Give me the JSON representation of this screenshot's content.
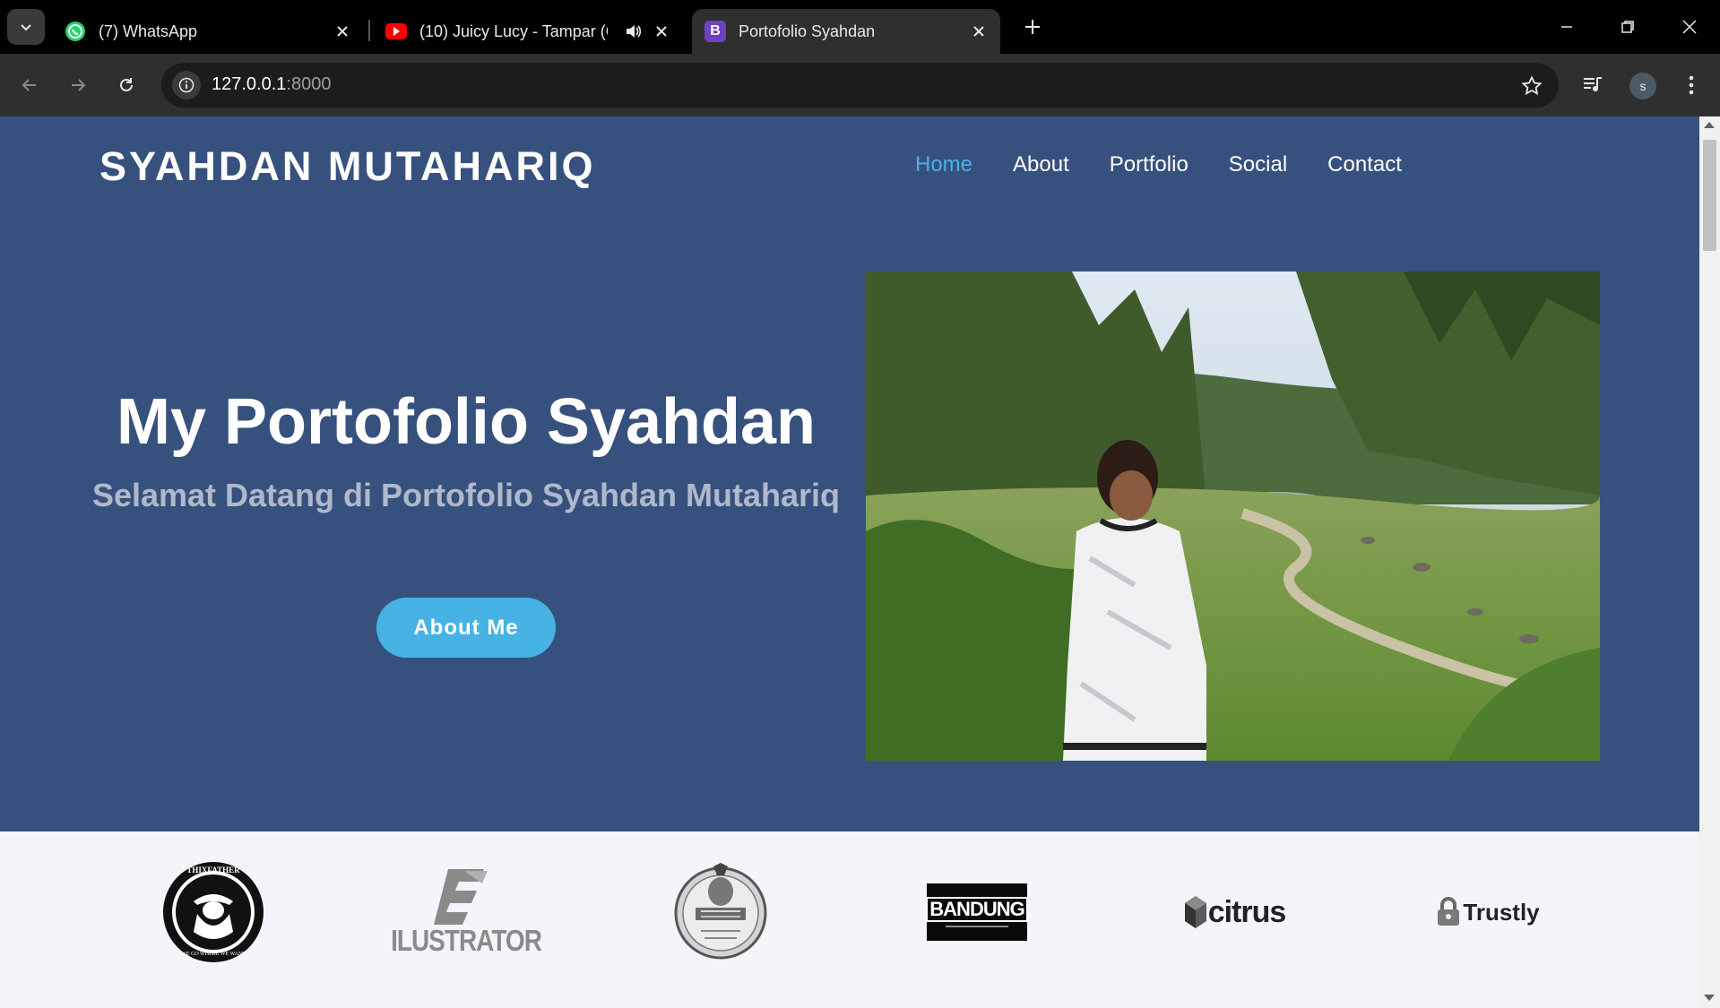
{
  "browser": {
    "tabs": [
      {
        "title": "(7) WhatsApp",
        "icon": "whatsapp-icon"
      },
      {
        "title": "(10) Juicy Lucy - Tampar (O",
        "icon": "youtube-icon"
      },
      {
        "title": "Portofolio Syahdan",
        "icon": "bootstrap-icon",
        "favicon_letter": "B"
      }
    ],
    "url_host": "127.0.0.1",
    "url_port": ":8000",
    "profile_initial": "s"
  },
  "page": {
    "brand": "SYAHDAN MUTAHARIQ",
    "nav": [
      "Home",
      "About",
      "Portfolio",
      "Social",
      "Contact"
    ],
    "active_nav": "Home",
    "hero_title": "My Portofolio Syahdan",
    "hero_subtitle": "Selamat Datang di Portofolio Syahdan Mutahariq",
    "hero_button": "About Me",
    "clients": [
      {
        "name": "thixfather-logo",
        "text": "THIXFATHER",
        "subtext": "WE GO WHERE WE WANT"
      },
      {
        "name": "ilustrator-logo",
        "text": "ILUSTRATOR"
      },
      {
        "name": "barber-logo",
        "text": ""
      },
      {
        "name": "bandung-logo",
        "text": "BANDUNG"
      },
      {
        "name": "citrus-logo",
        "text": "citrus"
      },
      {
        "name": "trustly-logo",
        "text": "Trustly"
      }
    ]
  },
  "colors": {
    "hero_bg": "#37517e",
    "accent": "#47b2e4",
    "clients_bg": "#f3f5fa"
  }
}
